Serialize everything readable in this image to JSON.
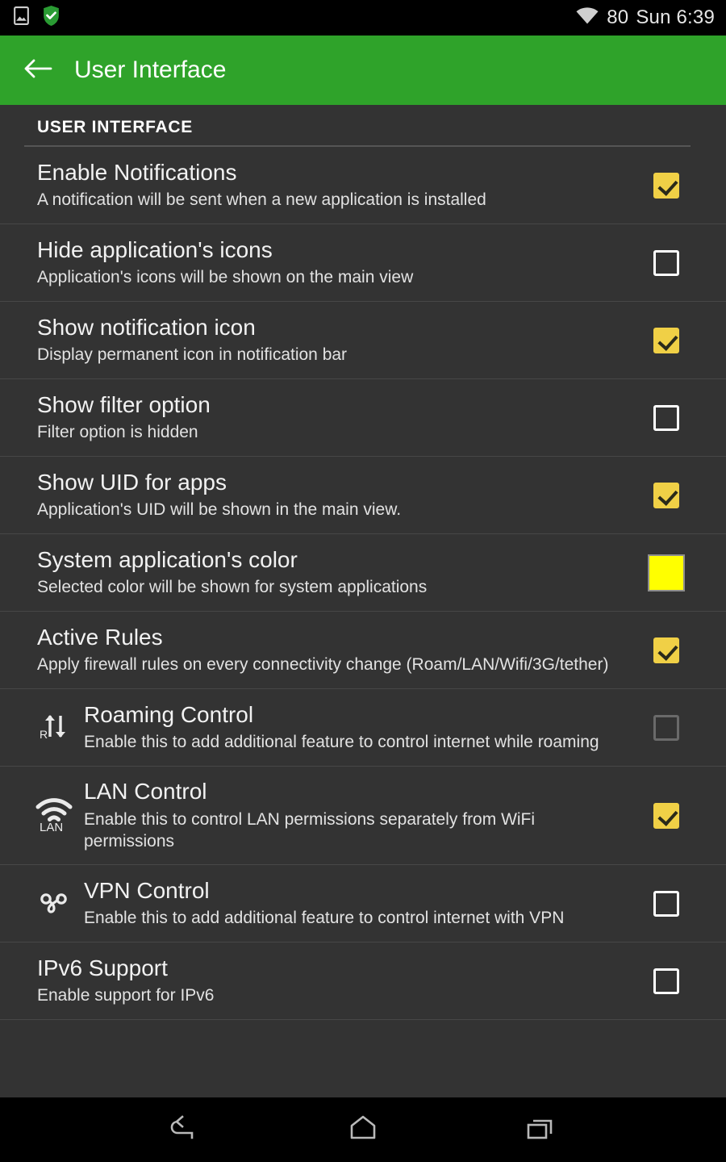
{
  "status_bar": {
    "icons": [
      "screenshot-icon",
      "shield-check-icon"
    ],
    "wifi_icon": "wifi-icon",
    "battery_level": "80",
    "clock": "Sun 6:39"
  },
  "action_bar": {
    "back_icon": "back-arrow-icon",
    "title": "User Interface"
  },
  "section": {
    "header": "USER INTERFACE"
  },
  "rows": [
    {
      "title": "Enable Notifications",
      "subtitle": "A notification will be sent when a new application is installed",
      "control": "checkbox",
      "checked": true,
      "indented": false,
      "icon": null,
      "disabled": false
    },
    {
      "title": "Hide application's icons",
      "subtitle": "Application's icons will be shown on the main view",
      "control": "checkbox",
      "checked": false,
      "indented": false,
      "icon": null,
      "disabled": false
    },
    {
      "title": "Show notification icon",
      "subtitle": "Display permanent icon in notification bar",
      "control": "checkbox",
      "checked": true,
      "indented": false,
      "icon": null,
      "disabled": false
    },
    {
      "title": "Show filter option",
      "subtitle": "Filter option is hidden",
      "control": "checkbox",
      "checked": false,
      "indented": false,
      "icon": null,
      "disabled": false
    },
    {
      "title": "Show UID for apps",
      "subtitle": "Application's UID will be shown in the main view.",
      "control": "checkbox",
      "checked": true,
      "indented": false,
      "icon": null,
      "disabled": false
    },
    {
      "title": "System application's color",
      "subtitle": "Selected color will be shown for system applications",
      "control": "color-swatch",
      "swatch_color": "#ffff00",
      "indented": false,
      "icon": null,
      "disabled": false
    },
    {
      "title": "Active Rules",
      "subtitle": "Apply firewall rules on every connectivity change (Roam/LAN/Wifi/3G/tether)",
      "control": "checkbox",
      "checked": true,
      "indented": false,
      "icon": null,
      "disabled": false
    },
    {
      "title": "Roaming Control",
      "subtitle": "Enable this to add additional feature to control internet while roaming",
      "control": "checkbox",
      "checked": false,
      "indented": true,
      "icon": "roaming-icon",
      "disabled": true
    },
    {
      "title": "LAN Control",
      "subtitle": "Enable this to control LAN permissions separately from WiFi permissions",
      "control": "checkbox",
      "checked": true,
      "indented": true,
      "icon": "lan-icon",
      "disabled": false
    },
    {
      "title": "VPN Control",
      "subtitle": "Enable this to add additional feature to control internet with VPN",
      "control": "checkbox",
      "checked": false,
      "indented": true,
      "icon": "vpn-icon",
      "disabled": false
    },
    {
      "title": "IPv6 Support",
      "subtitle": "Enable support for IPv6",
      "control": "checkbox",
      "checked": false,
      "indented": false,
      "icon": null,
      "disabled": false
    }
  ],
  "nav_bar": {
    "back_icon": "nav-back-icon",
    "home_icon": "nav-home-icon",
    "recents_icon": "nav-recents-icon"
  },
  "colors": {
    "accent_green": "#2fa32a",
    "background": "#333333",
    "checkbox_checked": "#f0d046",
    "swatch_yellow": "#ffff00"
  }
}
